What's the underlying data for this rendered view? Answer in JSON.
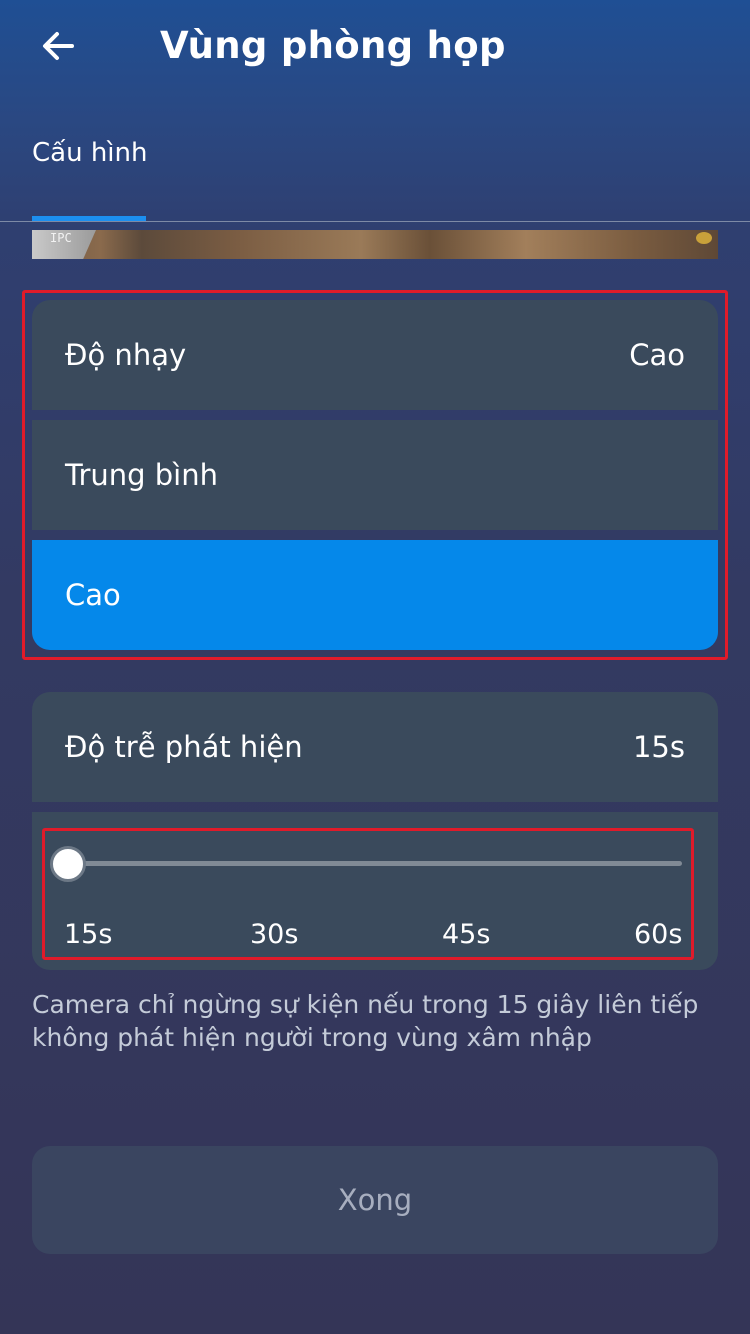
{
  "header": {
    "back_icon": "arrow-left-icon",
    "title": "Vùng phòng họp"
  },
  "tabs": [
    {
      "label": "Cấu hình",
      "active": true
    }
  ],
  "camera_preview": {
    "overlay_text": "IPC"
  },
  "sensitivity": {
    "label": "Độ nhạy",
    "value": "Cao",
    "options": [
      {
        "label": "Trung bình",
        "selected": false
      },
      {
        "label": "Cao",
        "selected": true
      }
    ]
  },
  "detection_delay": {
    "label": "Độ trễ phát hiện",
    "value": "15s",
    "slider": {
      "ticks": [
        "15s",
        "30s",
        "45s",
        "60s"
      ],
      "min": 15,
      "max": 60,
      "current": 15
    }
  },
  "description": "Camera chỉ ngừng sự kiện nếu trong 15 giây liên tiếp không phát hiện người trong vùng xâm nhập",
  "done_button": {
    "label": "Xong"
  },
  "colors": {
    "accent": "#0588ea",
    "card": "#3a4a5c",
    "highlight_border": "#e01b2a"
  }
}
